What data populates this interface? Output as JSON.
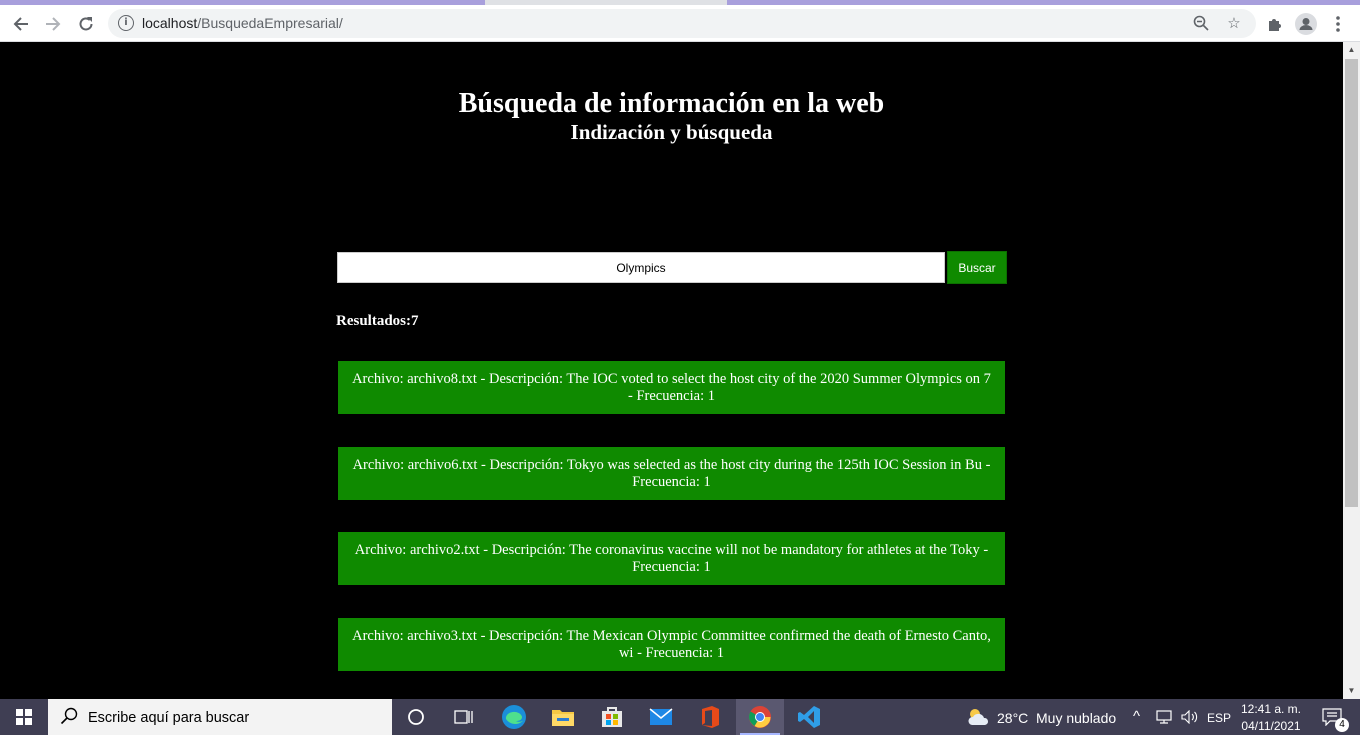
{
  "browser": {
    "url_host": "localhost",
    "url_path": "/BusquedaEmpresarial/",
    "back_icon": "arrow-left-icon",
    "forward_icon": "arrow-right-icon",
    "reload_icon": "reload-icon",
    "info_icon": "info-icon",
    "zoom_icon": "zoom-out-icon",
    "star_icon": "star-icon",
    "extensions_icon": "puzzle-icon",
    "profile_icon": "profile-icon",
    "menu_icon": "kebab-menu-icon"
  },
  "page": {
    "title": "Búsqueda de información en la web",
    "subtitle": "Indización y búsqueda",
    "search_value": "Olympics",
    "search_button": "Buscar",
    "results_label": "Resultados:7",
    "results": [
      {
        "text": "Archivo: archivo8.txt - Descripción: The IOC voted to select the host city of the 2020 Summer Olympics on 7 - Frecuencia: 1"
      },
      {
        "text": "Archivo: archivo6.txt - Descripción: Tokyo was selected as the host city during the 125th IOC Session in Bu - Frecuencia: 1"
      },
      {
        "text": "Archivo: archivo2.txt - Descripción: The coronavirus vaccine will not be mandatory for athletes at the Toky - Frecuencia: 1"
      },
      {
        "text": "Archivo: archivo3.txt - Descripción: The Mexican Olympic Committee confirmed the death of Ernesto Canto, wi - Frecuencia: 1"
      }
    ],
    "colors": {
      "background": "#000000",
      "result_bg": "#0f8a00",
      "button_bg": "#0f8a00"
    }
  },
  "taskbar": {
    "search_placeholder": "Escribe aquí para buscar",
    "weather_temp": "28°C",
    "weather_desc": "Muy nublado",
    "language": "ESP",
    "time": "12:41 a. m.",
    "date": "04/11/2021",
    "notifications_count": "4",
    "apps": [
      "cortana-icon",
      "task-view-icon",
      "edge-icon",
      "file-explorer-icon",
      "store-icon",
      "mail-icon",
      "office-icon",
      "chrome-icon",
      "vscode-icon"
    ]
  }
}
